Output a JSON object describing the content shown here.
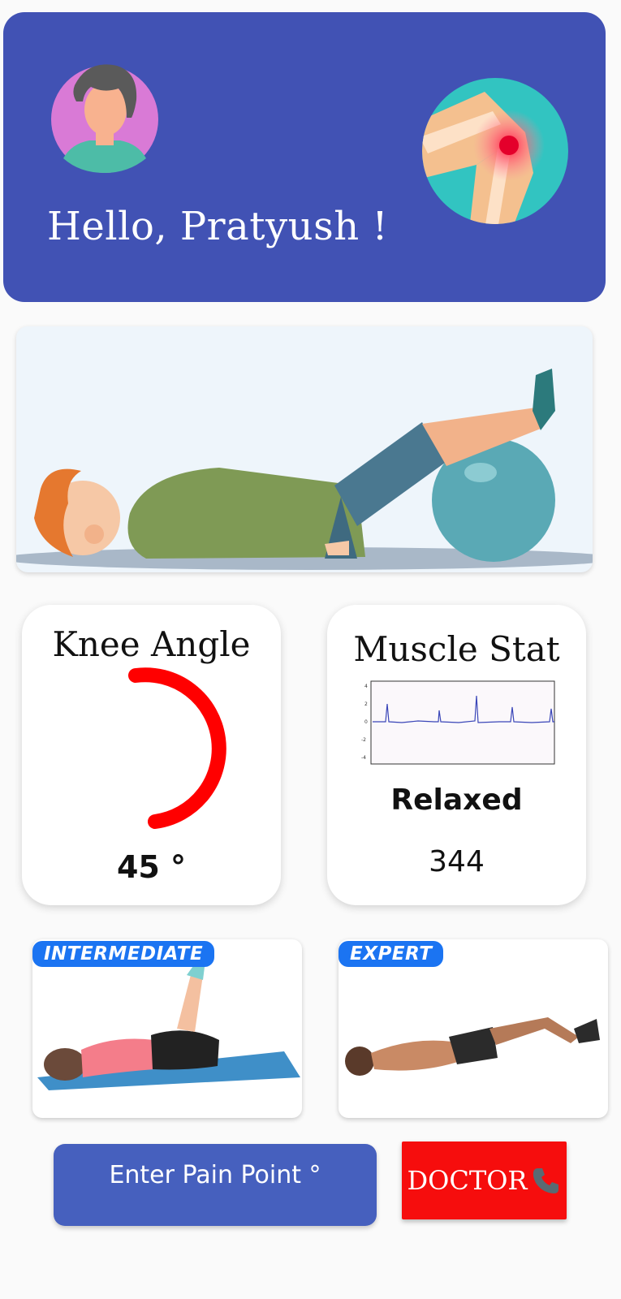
{
  "header": {
    "greeting": "Hello, Pratyush !",
    "avatar_icon": "user-avatar-icon",
    "knee_icon": "knee-pain-icon",
    "color": "#4152b4"
  },
  "hero": {
    "illustration": "person-leg-raise-on-exercise-ball"
  },
  "knee_angle": {
    "title": "Knee Angle",
    "value": "45 °",
    "gauge_color": "#ff0000"
  },
  "muscle_stat": {
    "title": "Muscle Stat",
    "status": "Relaxed",
    "value": "344",
    "line_color": "#3a46b8"
  },
  "levels": [
    {
      "label": "INTERMEDIATE",
      "image": "woman-lying-leg-raise-exercise"
    },
    {
      "label": "EXPERT",
      "image": "man-lying-hip-raise-exercise"
    }
  ],
  "actions": {
    "pain_point_label": "Enter Pain Point °",
    "doctor_label": "DOCTOR",
    "doctor_icon": "phone-icon"
  }
}
